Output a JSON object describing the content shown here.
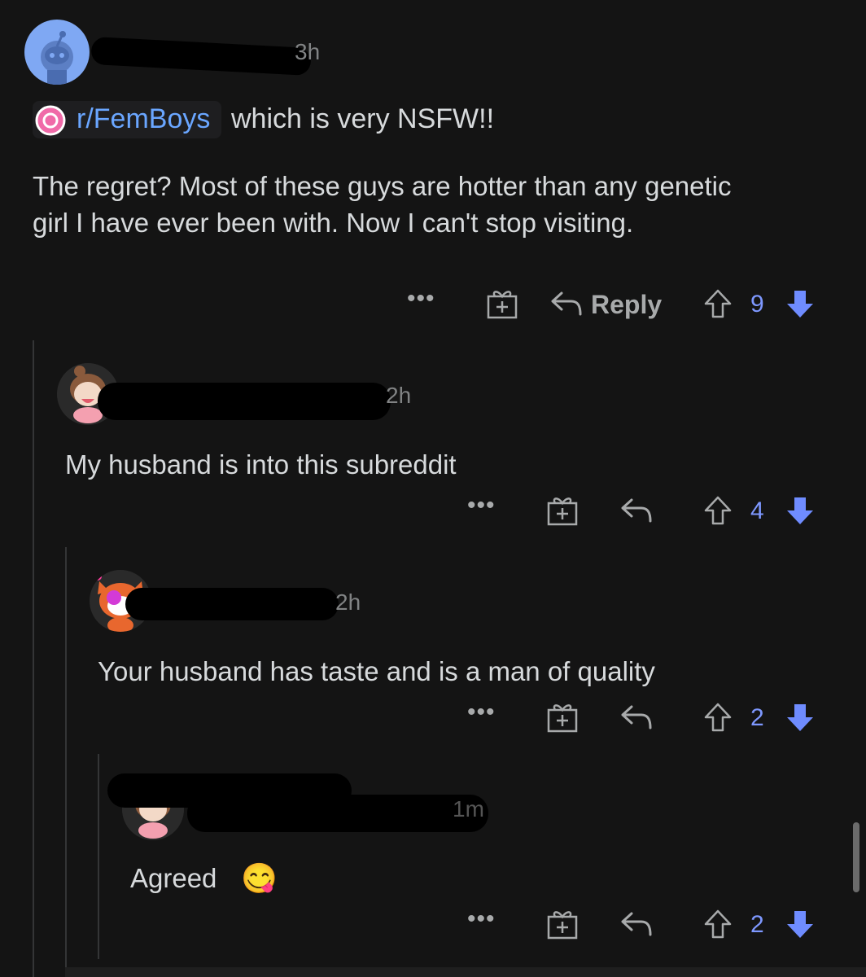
{
  "comments": [
    {
      "time": "3h",
      "subreddit": "r/FemBoys",
      "body_suffix": " which is very NSFW!!",
      "body": "The regret? Most of these guys are hotter than any genetic girl I have ever been with. Now I can't stop visiting.",
      "reply_label": "Reply",
      "score": "9"
    },
    {
      "time": "2h",
      "body": "My husband is into this subreddit",
      "score": "4"
    },
    {
      "time": "2h",
      "body": "Your husband has taste and is a man of quality",
      "score": "2"
    },
    {
      "time": "1m",
      "body": "Agreed",
      "emoji": "😋",
      "score": "2"
    }
  ],
  "icons": {
    "more": "more-options-icon",
    "gift": "award-icon",
    "reply": "reply-arrow-icon",
    "upvote": "upvote-icon",
    "downvote": "downvote-icon"
  },
  "colors": {
    "background": "#141414",
    "text": "#d7dadc",
    "link": "#6aa6ff",
    "vote_count": "#7e98ff",
    "downvote": "#6f8cff"
  },
  "actions": {
    "more_label": "•••"
  }
}
